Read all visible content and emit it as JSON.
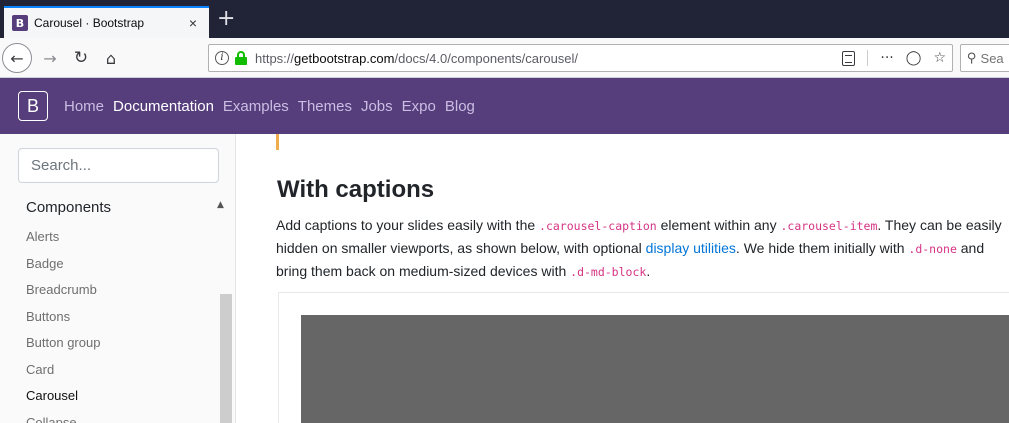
{
  "browser": {
    "tab_title": "Carousel · Bootstrap",
    "tab_favicon_letter": "B",
    "tab_close": "×",
    "new_tab": "+",
    "url_prefix": "https://",
    "url_host": "getbootstrap.com",
    "url_path": "/docs/4.0/components/carousel/",
    "search_placeholder": "Sea",
    "more_actions": "···"
  },
  "site_nav": {
    "logo_letter": "B",
    "links": [
      {
        "label": "Home",
        "active": false
      },
      {
        "label": "Documentation",
        "active": true
      },
      {
        "label": "Examples",
        "active": false
      },
      {
        "label": "Themes",
        "active": false
      },
      {
        "label": "Jobs",
        "active": false
      },
      {
        "label": "Expo",
        "active": false
      },
      {
        "label": "Blog",
        "active": false
      }
    ]
  },
  "sidebar": {
    "search_placeholder": "Search...",
    "group_label": "Components",
    "items": [
      "Alerts",
      "Badge",
      "Breadcrumb",
      "Buttons",
      "Button group",
      "Card",
      "Carousel",
      "Collapse"
    ],
    "active_item": "Carousel"
  },
  "content": {
    "heading": "With captions",
    "para_1": "Add captions to your slides easily with the ",
    "code_1": ".carousel-caption",
    "para_2": " element within any ",
    "code_2": ".carousel-item",
    "para_3": ". They can be easily hidden on smaller viewports, as shown below, with optional ",
    "link_1": "display utilities",
    "para_4": ". We hide them initially with ",
    "code_3": ".d-none",
    "para_5": " and bring them back on medium-sized devices with ",
    "code_4": ".d-md-block",
    "para_6": "."
  },
  "colors": {
    "brand_purple": "#563d7c",
    "link_blue": "#0275d8",
    "code_pink": "#d63384",
    "slide_gray": "#666666"
  }
}
